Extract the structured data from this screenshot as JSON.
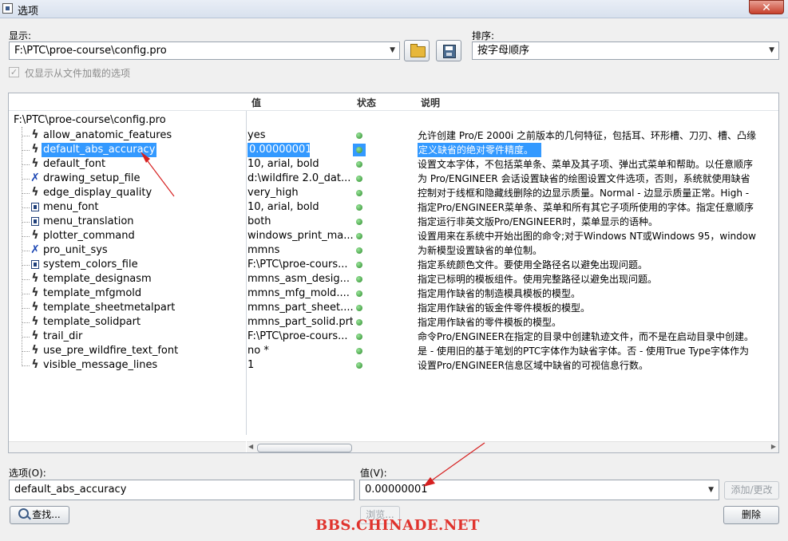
{
  "window": {
    "title": "选项",
    "close_label": "✕"
  },
  "display": {
    "label": "显示:",
    "value": "F:\\PTC\\proe-course\\config.pro"
  },
  "sort": {
    "label": "排序:",
    "value": "按字母顺序"
  },
  "show_loaded_only": {
    "label": "仅显示从文件加载的选项",
    "checked": true
  },
  "table": {
    "headers": {
      "value": "值",
      "status": "状态",
      "description": "说明"
    },
    "root": "F:\\PTC\\proe-course\\config.pro",
    "rows": [
      {
        "icon": "bolt-icon",
        "name": "allow_anatomic_features",
        "value": "yes",
        "desc": "允许创建 Pro/E 2000i 之前版本的几何特征，包括耳、环形槽、刀刃、槽、凸缘"
      },
      {
        "icon": "bolt-icon",
        "name": "default_abs_accuracy",
        "value": "0.00000001",
        "desc": "定义缺省的绝对零件精度。",
        "selected": true
      },
      {
        "icon": "bolt-icon",
        "name": "default_font",
        "value": "10, arial, bold",
        "desc": "设置文本字体，不包括菜单条、菜单及其子项、弹出式菜单和帮助。以任意顺序"
      },
      {
        "icon": "wrench-icon",
        "name": "drawing_setup_file",
        "value": "d:\\wildfire 2.0_dat...",
        "desc": "为 Pro/ENGINEER 会话设置缺省的绘图设置文件选项，否则，系统就使用缺省"
      },
      {
        "icon": "bolt-icon",
        "name": "edge_display_quality",
        "value": "very_high",
        "desc": "控制对于线框和隐藏线删除的边显示质量。Normal - 边显示质量正常。High -"
      },
      {
        "icon": "panel-icon",
        "name": "menu_font",
        "value": "10, arial, bold",
        "desc": "指定Pro/ENGINEER菜单条、菜单和所有其它子项所使用的字体。指定任意顺序"
      },
      {
        "icon": "panel-icon",
        "name": "menu_translation",
        "value": "both",
        "desc": "指定运行非英文版Pro/ENGINEER时，菜单显示的语种。"
      },
      {
        "icon": "bolt-icon",
        "name": "plotter_command",
        "value": "windows_print_ma...",
        "desc": "设置用来在系统中开始出图的命令;对于Windows NT或Windows 95，window"
      },
      {
        "icon": "wrench-icon",
        "name": "pro_unit_sys",
        "value": "mmns",
        "desc": "为新模型设置缺省的单位制。"
      },
      {
        "icon": "panel-icon",
        "name": "system_colors_file",
        "value": "F:\\PTC\\proe-cours...",
        "desc": "指定系统颜色文件。要使用全路径名以避免出现问题。"
      },
      {
        "icon": "bolt-icon",
        "name": "template_designasm",
        "value": "mmns_asm_desig...",
        "desc": "指定已标明的模板组件。使用完整路径以避免出现问题。"
      },
      {
        "icon": "bolt-icon",
        "name": "template_mfgmold",
        "value": "mmns_mfg_mold....",
        "desc": "指定用作缺省的制造模具模板的模型。"
      },
      {
        "icon": "bolt-icon",
        "name": "template_sheetmetalpart",
        "value": "mmns_part_sheet....",
        "desc": "指定用作缺省的钣金件零件模板的模型。"
      },
      {
        "icon": "bolt-icon",
        "name": "template_solidpart",
        "value": "mmns_part_solid.prt",
        "desc": "指定用作缺省的零件模板的模型。"
      },
      {
        "icon": "bolt-icon",
        "name": "trail_dir",
        "value": "F:\\PTC\\proe-cours...",
        "desc": "命令Pro/ENGINEER在指定的目录中创建轨迹文件，而不是在启动目录中创建。"
      },
      {
        "icon": "bolt-icon",
        "name": "use_pre_wildfire_text_font",
        "value": "no *",
        "desc": "是 - 使用旧的基于笔划的PTC字体作为缺省字体。否 - 使用True Type字体作为"
      },
      {
        "icon": "bolt-icon",
        "name": "visible_message_lines",
        "value": "1",
        "desc": "设置Pro/ENGINEER信息区域中缺省的可视信息行数。"
      }
    ]
  },
  "option_field": {
    "label": "选项(O):",
    "value": "default_abs_accuracy"
  },
  "value_field": {
    "label": "值(V):",
    "value": "0.00000001"
  },
  "buttons": {
    "add_change": "添加/更改",
    "find": "查找...",
    "browse": "浏览...",
    "delete": "删除"
  },
  "watermark": "BBS.CHINADE.NET",
  "colors": {
    "selection": "#3399ff",
    "status_ok": "#2a8a2a",
    "annotation_arrow": "#d62020",
    "watermark": "#e0332d"
  }
}
